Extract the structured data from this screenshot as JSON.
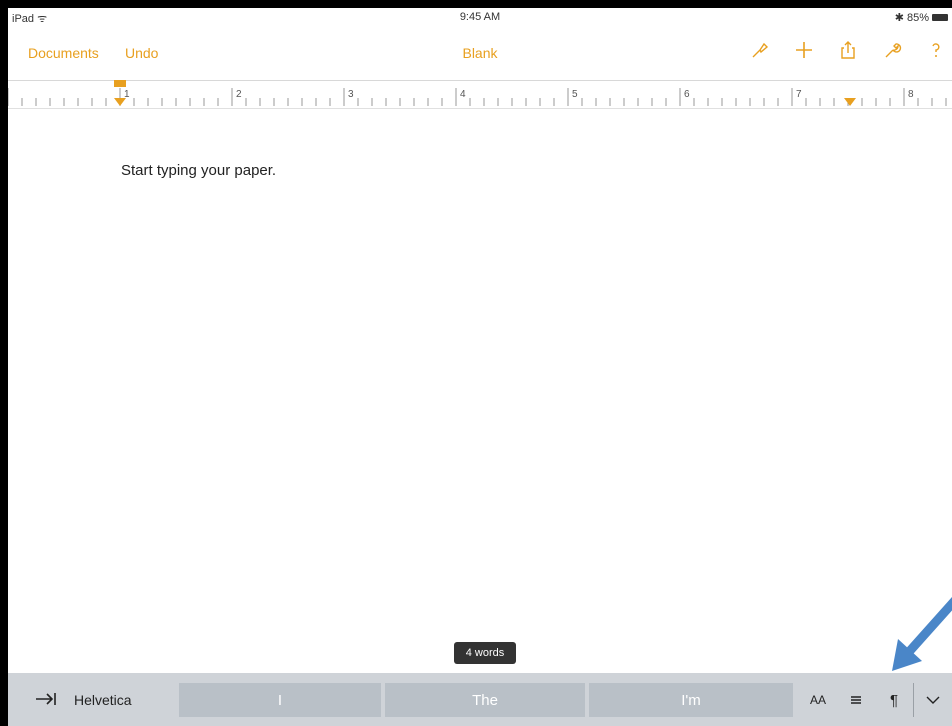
{
  "status_bar": {
    "carrier": "iPad",
    "time": "9:45 AM",
    "battery": "85%"
  },
  "nav": {
    "documents_label": "Documents",
    "undo_label": "Undo",
    "title": "Blank",
    "icons": [
      "paintbrush-icon",
      "plus-icon",
      "share-icon",
      "wrench-icon",
      "help-icon"
    ]
  },
  "ruler": {
    "numbers": [
      "1",
      "2",
      "3",
      "4",
      "5",
      "6",
      "7",
      "8"
    ]
  },
  "document": {
    "body_text": "Start typing your paper."
  },
  "word_count": "4 words",
  "shortcut_bar": {
    "font_name": "Helvetica",
    "suggestions": [
      "I",
      "The",
      "I'm"
    ],
    "text_size_label": "AA",
    "paragraph_label": "¶"
  },
  "colors": {
    "accent": "#e8a020",
    "bar_background": "#cfd3d8",
    "suggestion_background": "#b9c0c7",
    "annotation_arrow": "#4a86c8"
  }
}
